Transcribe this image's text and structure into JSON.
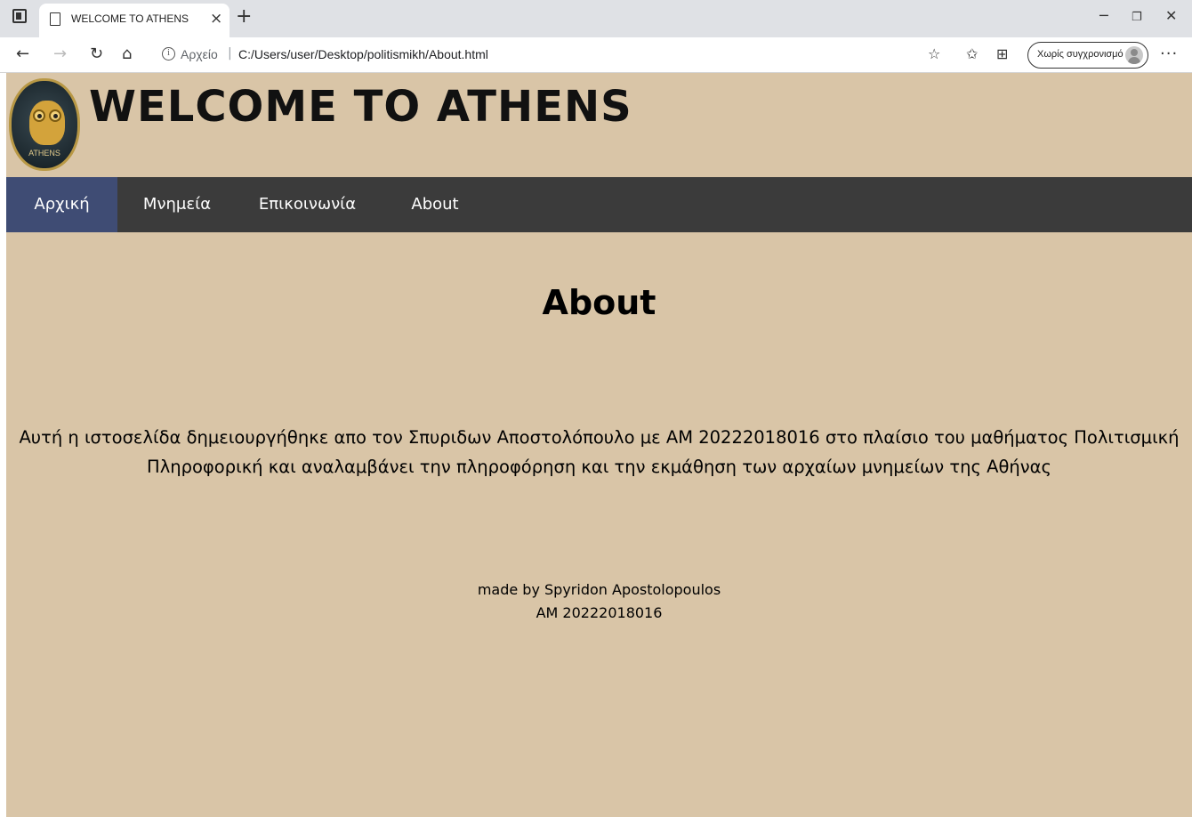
{
  "browser": {
    "tab_title": "WELCOME TO ATHENS",
    "tab_close": "×",
    "new_tab": "+",
    "address_label": "Αρχείο",
    "address_sep": "|",
    "url": "C:/Users/user/Desktop/politismikh/About.html",
    "sync_label": "Χωρίς συγχρονισμό",
    "more": "···"
  },
  "site": {
    "logo_text": "ATHENS",
    "title": "WELCOME TO ATHENS",
    "nav": [
      {
        "label": "Αρχική",
        "active": true
      },
      {
        "label": "Μνημεία",
        "active": false
      },
      {
        "label": "Επικοινωνία",
        "active": false
      },
      {
        "label": "About",
        "active": false
      }
    ]
  },
  "about": {
    "heading": "About",
    "paragraph_line1": "Αυτή η ιστοσελίδα δημειουργήθηκε απο τον Σπυριδων Αποστολόπουλο με ΑΜ 20222018016 στο πλαίσιο του μαθήματος Πολιτισμική",
    "paragraph_line2": "Πληροφορική και αναλαμβάνει την πληροφόρηση και την εκμάθηση των αρχαίων μνημείων της Αθήνας",
    "credit_line1": "made by Spyridon Apostolopoulos",
    "credit_line2": "AM 20222018016"
  },
  "colors": {
    "page_bg": "#d9c5a7",
    "nav_bg": "#3b3b3b",
    "nav_active": "#3f4c74"
  }
}
